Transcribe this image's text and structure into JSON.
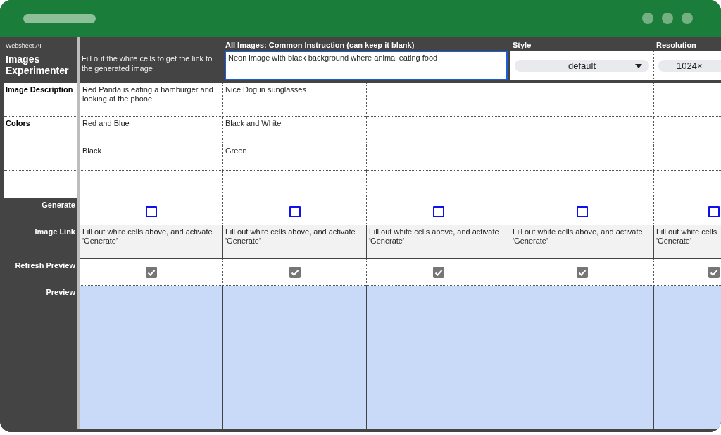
{
  "app": {
    "brand": "Websheet AI",
    "title": "Images Experimenter",
    "hint": "Fill out the white cells to get the link to the generated image"
  },
  "common_instruction": {
    "label": "All Images: Common Instruction (can keep it  blank)",
    "value": "Neon image with black background where animal eating food"
  },
  "style": {
    "label": "Style",
    "value": "default"
  },
  "resolution": {
    "label": "Resolution",
    "value": "1024×"
  },
  "input_rows": [
    {
      "label": "Image Description"
    },
    {
      "label": "Colors"
    },
    {},
    {}
  ],
  "control_rows": {
    "generate": "Generate",
    "link": "Image Link",
    "refresh": "Refresh Preview",
    "preview": "Preview"
  },
  "columns": [
    {
      "cells": [
        "Red Panda is eating a hamburger and looking at the phone",
        "Red and Blue",
        "Black"
      ],
      "generate": false,
      "link": "Fill out white cells above, and activate 'Generate'",
      "refresh": true
    },
    {
      "cells": [
        "Nice Dog in sunglasses",
        "Black and White",
        "Green"
      ],
      "generate": false,
      "link": "Fill out white cells above, and activate 'Generate'",
      "refresh": true
    },
    {
      "generate": false,
      "link": "Fill out white cells above, and activate 'Generate'",
      "refresh": true
    },
    {
      "generate": false,
      "link": "Fill out white cells above, and activate 'Generate'",
      "refresh": true
    },
    {
      "generate": false,
      "link": "Fill out white cells\n'Generate'",
      "refresh": true
    }
  ]
}
